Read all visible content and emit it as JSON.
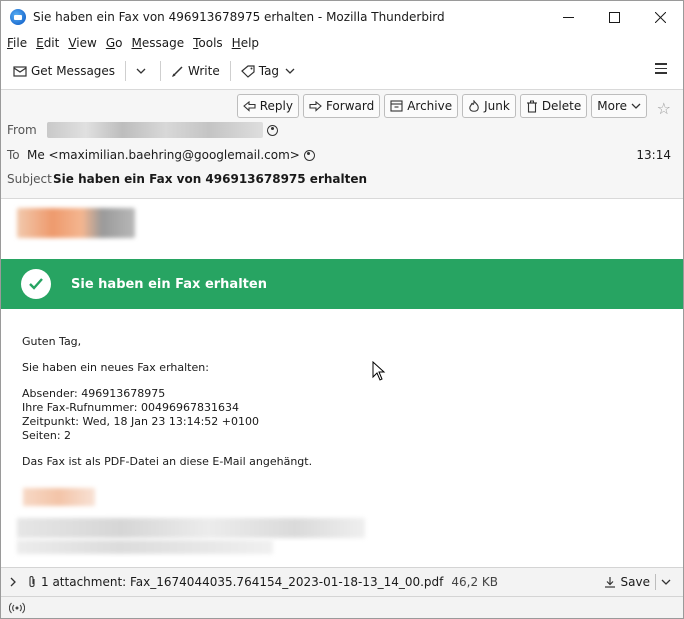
{
  "window": {
    "title": "Sie haben ein Fax von 496913678975 erhalten - Mozilla Thunderbird"
  },
  "menu": [
    {
      "label": "File",
      "key": "F",
      "rest": "ile"
    },
    {
      "label": "Edit",
      "key": "E",
      "rest": "dit"
    },
    {
      "label": "View",
      "key": "V",
      "rest": "iew"
    },
    {
      "label": "Go",
      "key": "G",
      "rest": "o"
    },
    {
      "label": "Message",
      "key": "M",
      "rest": "essage"
    },
    {
      "label": "Tools",
      "key": "T",
      "rest": "ools"
    },
    {
      "label": "Help",
      "key": "H",
      "rest": "elp"
    }
  ],
  "toolbar": {
    "get_messages": "Get Messages",
    "write": "Write",
    "tag": "Tag"
  },
  "actions": {
    "reply": "Reply",
    "forward": "Forward",
    "archive": "Archive",
    "junk": "Junk",
    "delete": "Delete",
    "more": "More"
  },
  "header": {
    "from_label": "From",
    "to_label": "To",
    "to_value": "Me <maximilian.baehring@googlemail.com>",
    "subject_label": "Subject",
    "subject_value": "Sie haben ein Fax von 496913678975 erhalten",
    "time": "13:14"
  },
  "body": {
    "banner": "Sie haben ein Fax erhalten",
    "greeting": "Guten Tag,",
    "intro": "Sie haben ein neues Fax erhalten:",
    "sender": "Absender: 496913678975",
    "fax_number": "Ihre Fax-Rufnummer: 00496967831634",
    "timestamp": "Zeitpunkt: Wed, 18 Jan 23 13:14:52 +0100",
    "pages": "Seiten: 2",
    "note": "Das Fax ist als PDF-Datei an diese E-Mail angehängt."
  },
  "attachment": {
    "summary": "1 attachment: Fax_1674044035.764154_2023-01-18-13_14_00.pdf",
    "size": "46,2 KB",
    "save": "Save"
  },
  "colors": {
    "banner_green": "#27a462"
  }
}
